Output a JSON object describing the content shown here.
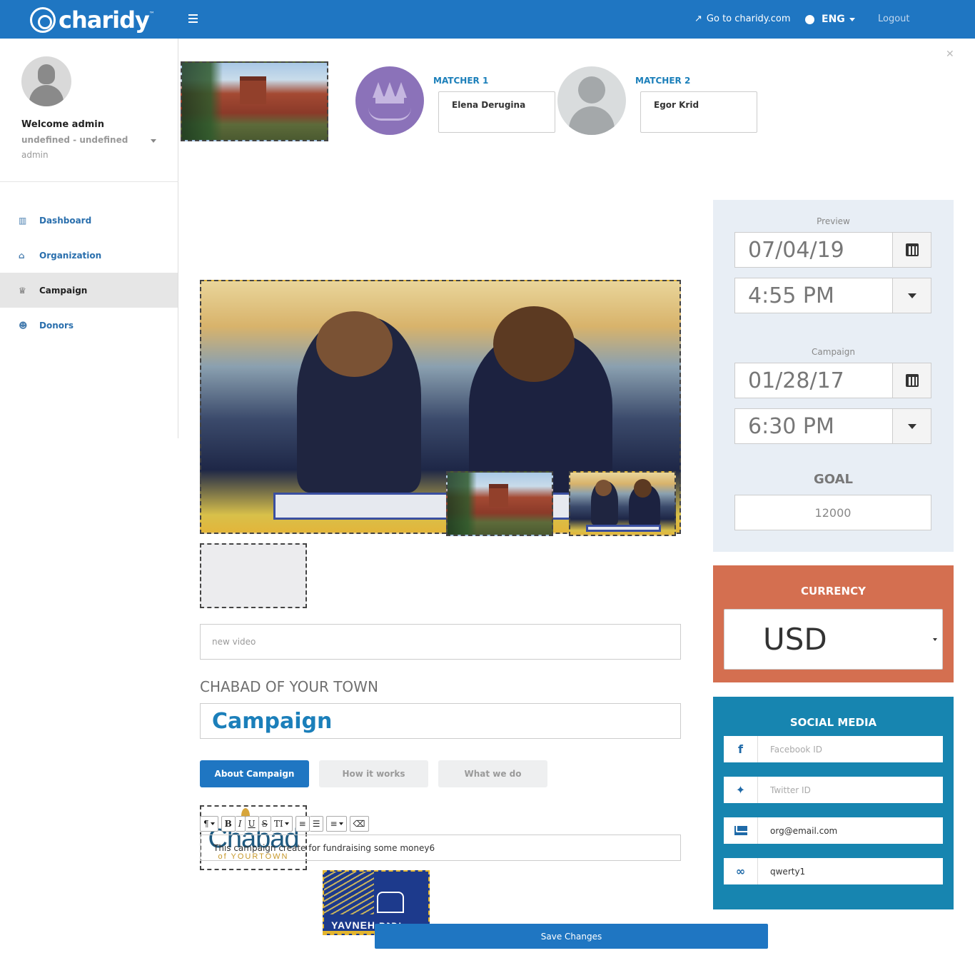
{
  "header": {
    "logo_text": "charidy",
    "goto_link": "Go to charidy.com",
    "language": "ENG",
    "logout": "Logout",
    "bg_color": "#1f76c2"
  },
  "sidebar": {
    "welcome": "Welcome admin",
    "user_line": "undefined - undefined",
    "role": "admin",
    "items": [
      {
        "label": "Dashboard",
        "icon": "bar-chart-icon",
        "active": false
      },
      {
        "label": "Organization",
        "icon": "bank-icon",
        "active": false
      },
      {
        "label": "Campaign",
        "icon": "trophy-icon",
        "active": true
      },
      {
        "label": "Donors",
        "icon": "users-icon",
        "active": false
      }
    ]
  },
  "matchers": [
    {
      "label": "MATCHER 1",
      "name": "Elena Derugina"
    },
    {
      "label": "MATCHER 2",
      "name": "Egor Krid"
    }
  ],
  "media": {
    "thumbnails": [
      "Chabad of YourTown logo",
      "Yavneh logo",
      "school building",
      "classroom kids"
    ],
    "chabad_word": "Chabad",
    "chabad_sub": "of YOURTOWN",
    "yavneh_name": "YAVNEH יבנה",
    "video_placeholder": "new video"
  },
  "campaign": {
    "org_name": "CHABAD OF YOUR TOWN",
    "title": "Campaign",
    "tabs": [
      "About Campaign",
      "How it works",
      "What we do"
    ],
    "active_tab": "About Campaign",
    "description": "This campaign create for fundraising some money6"
  },
  "editor_toolbar": {
    "paragraph": "¶",
    "bold": "B",
    "italic": "I",
    "underline": "U",
    "strike": "S",
    "text_size": "TI"
  },
  "dates": {
    "preview_label": "Preview",
    "preview_date": "07/04/19",
    "preview_time": "4:55 PM",
    "campaign_label": "Campaign",
    "campaign_date": "01/28/17",
    "campaign_time": "6:30 PM",
    "goal_label": "GOAL",
    "goal_value": "12000"
  },
  "currency": {
    "label": "CURRENCY",
    "value": "USD",
    "panel_color": "#d46f50"
  },
  "social": {
    "label": "SOCIAL MEDIA",
    "facebook_placeholder": "Facebook ID",
    "twitter_placeholder": "Twitter ID",
    "email": "org@email.com",
    "link": "qwerty1",
    "panel_color": "#1785b0"
  },
  "save_label": "Save Changes"
}
